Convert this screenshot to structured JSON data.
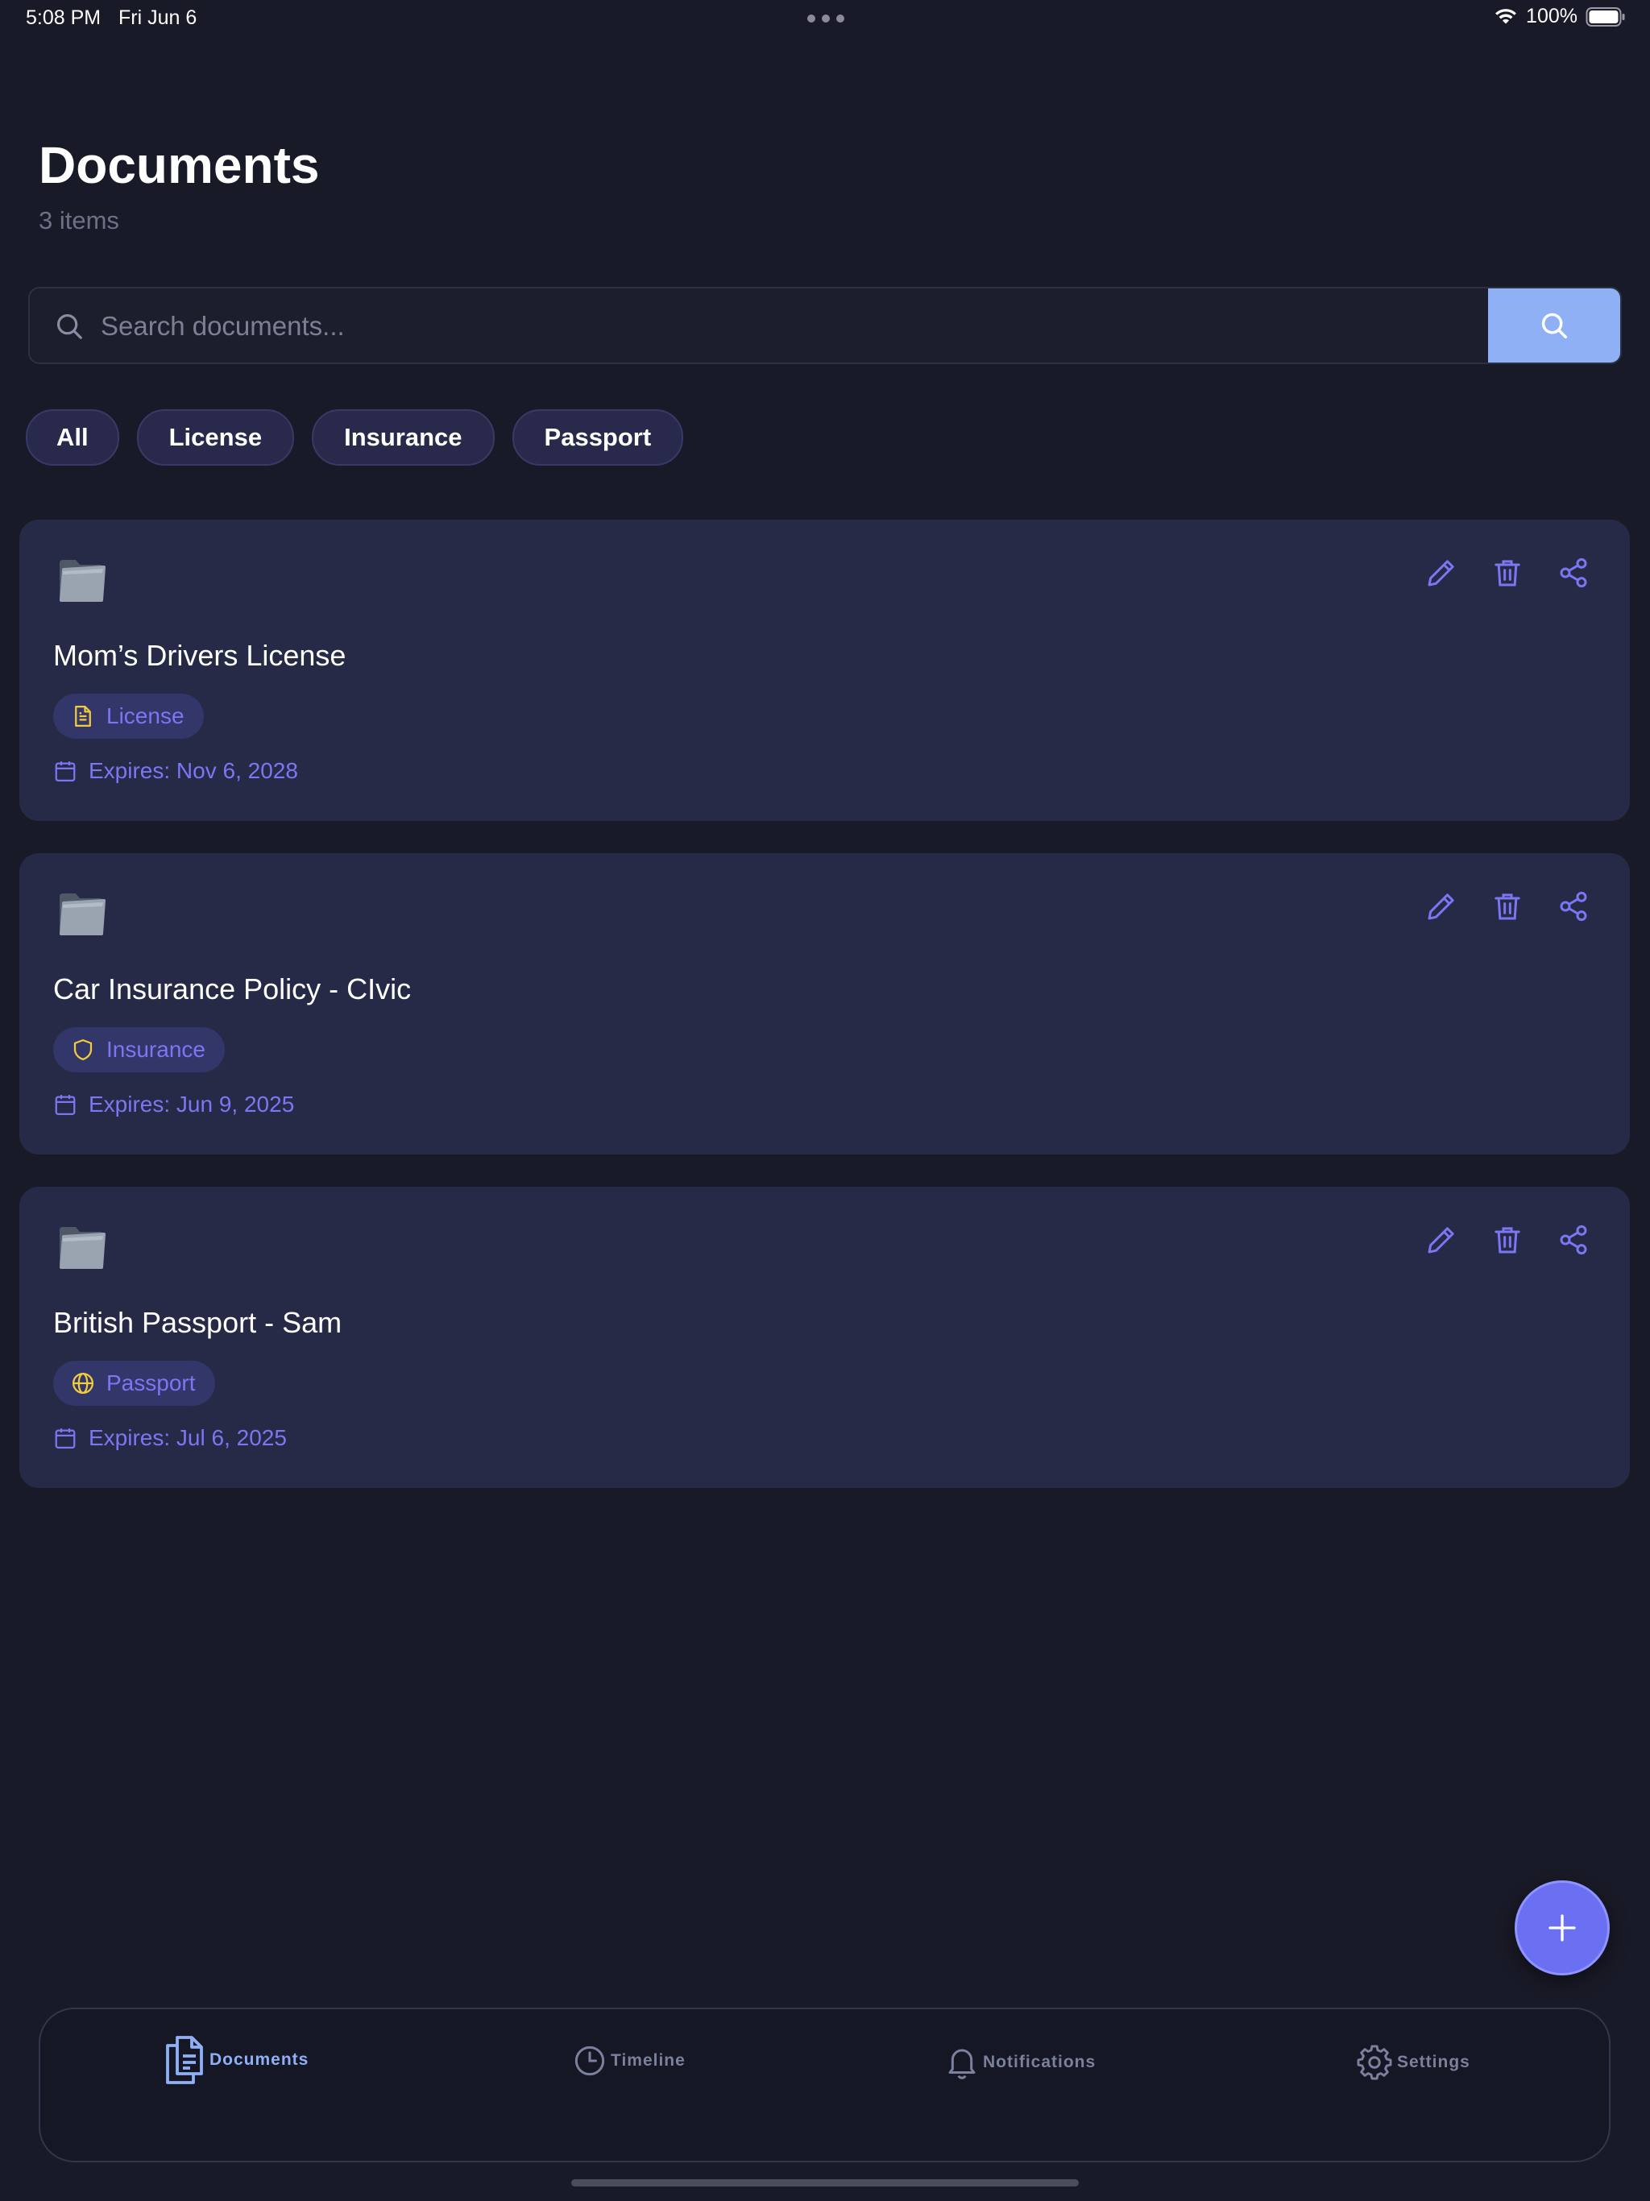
{
  "status_bar": {
    "time": "5:08 PM",
    "date": "Fri Jun 6",
    "battery": "100%"
  },
  "header": {
    "title": "Documents",
    "subtitle": "3 items"
  },
  "search": {
    "placeholder": "Search documents..."
  },
  "filters": [
    "All",
    "License",
    "Insurance",
    "Passport"
  ],
  "documents": [
    {
      "title": "Mom’s Drivers License",
      "type": "License",
      "type_icon": "document-icon",
      "expiry": "Expires: Nov 6, 2028"
    },
    {
      "title": "Car Insurance Policy - CIvic",
      "type": "Insurance",
      "type_icon": "shield-icon",
      "expiry": "Expires: Jun 9, 2025"
    },
    {
      "title": "British Passport - Sam",
      "type": "Passport",
      "type_icon": "globe-icon",
      "expiry": "Expires: Jul 6, 2025"
    }
  ],
  "tabs": [
    {
      "label": "Documents",
      "icon": "documents-icon",
      "active": true
    },
    {
      "label": "Timeline",
      "icon": "clock-icon",
      "active": false
    },
    {
      "label": "Notifications",
      "icon": "bell-icon",
      "active": false
    },
    {
      "label": "Settings",
      "icon": "gear-icon",
      "active": false
    }
  ],
  "colors": {
    "background": "#191a27",
    "card": "#262a47",
    "accent": "#7b76f3",
    "search_button": "#8fb0f5",
    "fab": "#6b6ff2",
    "badge_icon": "#f2cc3c"
  }
}
